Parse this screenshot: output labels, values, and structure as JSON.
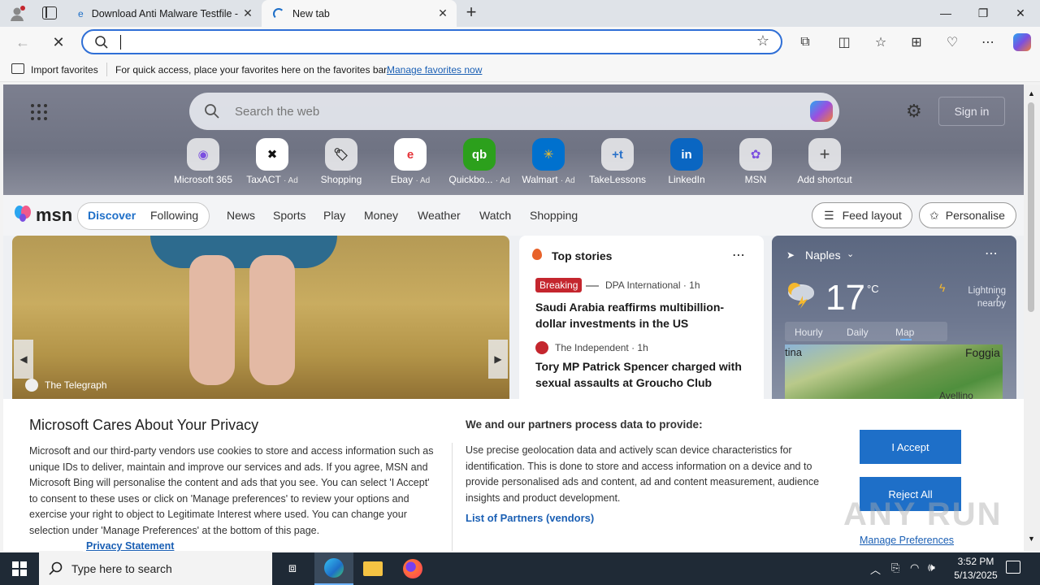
{
  "tabs": [
    {
      "title": "Download Anti Malware Testfile -"
    },
    {
      "title": "New tab"
    }
  ],
  "address": {
    "value": ""
  },
  "favorites_bar": {
    "import_label": "Import favorites",
    "hint": "For quick access, place your favorites here on the favorites bar.",
    "manage_link": "Manage favorites now"
  },
  "ntp": {
    "search_placeholder": "Search the web",
    "sign_in": "Sign in",
    "shortcuts": [
      {
        "label": "Microsoft 365",
        "ad": ""
      },
      {
        "label": "TaxACT",
        "ad": "· Ad"
      },
      {
        "label": "Shopping",
        "ad": ""
      },
      {
        "label": "Ebay",
        "ad": "· Ad"
      },
      {
        "label": "Quickbo...",
        "ad": "· Ad"
      },
      {
        "label": "Walmart",
        "ad": "· Ad"
      },
      {
        "label": "TakeLessons",
        "ad": ""
      },
      {
        "label": "LinkedIn",
        "ad": ""
      },
      {
        "label": "MSN",
        "ad": ""
      },
      {
        "label": "Add shortcut",
        "ad": ""
      }
    ],
    "msn_logo": "msn",
    "nav": [
      "Discover",
      "Following",
      "News",
      "Sports",
      "Play",
      "Money",
      "Weather",
      "Watch",
      "Shopping"
    ],
    "feed_layout": "Feed layout",
    "personalise": "Personalise",
    "hero_source": "The Telegraph",
    "top_stories": {
      "title": "Top stories",
      "items": [
        {
          "badge": "Breaking",
          "source": "DPA International · 1h",
          "headline": "Saudi Arabia reaffirms multibillion-dollar investments in the US"
        },
        {
          "badge": "",
          "source": "The Independent · 1h",
          "headline": "Tory MP Patrick Spencer charged with sexual assaults at Groucho Club"
        }
      ]
    },
    "weather": {
      "location": "Naples",
      "temp": "17",
      "unit": "°C",
      "alert": "Lightning nearby",
      "tabs": [
        "Hourly",
        "Daily",
        "Map"
      ],
      "map_labels": [
        "tina",
        "Foggia",
        "Avellino"
      ]
    }
  },
  "privacy": {
    "title": "Microsoft Cares About Your Privacy",
    "body": "Microsoft and our third-party vendors use cookies to store and access information such as unique IDs to deliver, maintain and improve our services and ads. If you agree, MSN and Microsoft Bing will personalise the content and ads that you see. You can select 'I Accept' to consent to these uses or click on 'Manage preferences' to review your options and exercise your right to object to Legitimate Interest where used. You can change your selection under 'Manage Preferences' at the bottom of this page.",
    "statement_link": "Privacy Statement",
    "purposes_title": "We and our partners process data to provide:",
    "purposes_body": "Use precise geolocation data and actively scan device characteristics for identification. This is done to store and access information on a device and to provide personalised ads and content, ad and content measurement, audience insights and product development.",
    "partners_link": "List of Partners (vendors)",
    "accept": "I Accept",
    "reject": "Reject All",
    "manage": "Manage Preferences"
  },
  "taskbar": {
    "search_placeholder": "Type here to search",
    "time": "3:52 PM",
    "date": "5/13/2025"
  },
  "watermark": "ANY RUN",
  "colors": {
    "accent": "#1e6fc8",
    "breaking": "#c4262e",
    "taskbar": "#1f2a36"
  }
}
